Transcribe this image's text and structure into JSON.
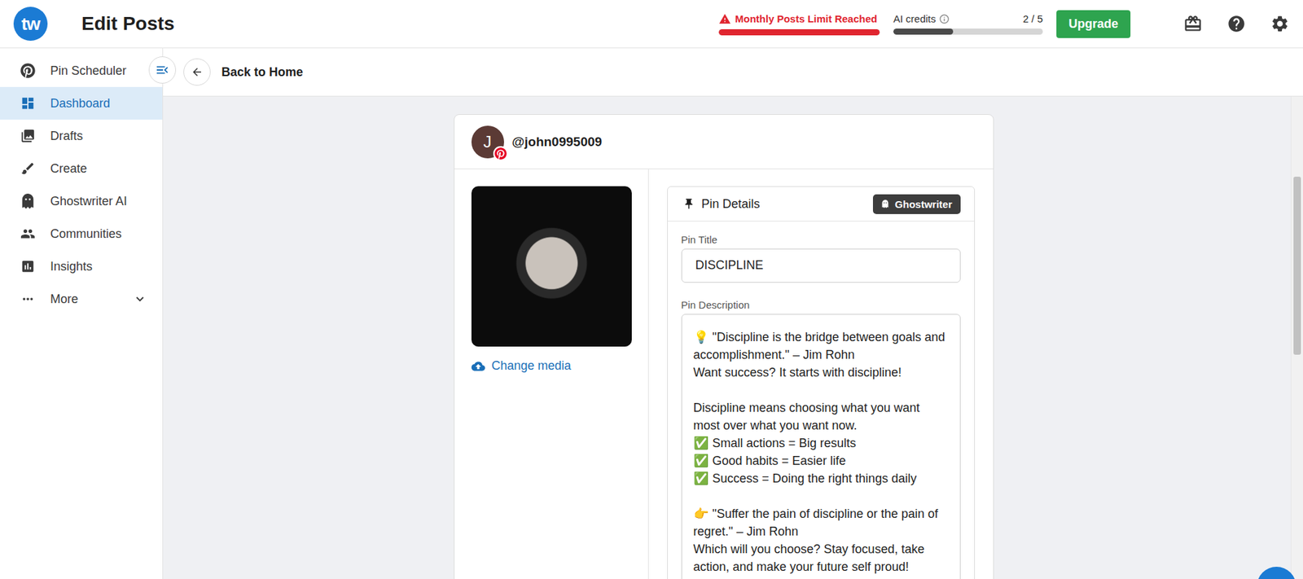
{
  "header": {
    "logo": "tw",
    "title": "Edit Posts",
    "limit_warning": {
      "label": "Monthly Posts Limit Reached",
      "level": 1
    },
    "credits": {
      "label": "AI credits",
      "reading": "2 / 5",
      "level": 0.4
    },
    "upgrade_button": "Upgrade"
  },
  "sidebar": {
    "items": [
      {
        "label": "Pin Scheduler",
        "icon": "pinterest",
        "selected": false
      },
      {
        "label": "Dashboard",
        "icon": "dashboard",
        "selected": true
      },
      {
        "label": "Drafts",
        "icon": "drafts",
        "selected": false
      },
      {
        "label": "Create",
        "icon": "create",
        "selected": false
      },
      {
        "label": "Ghostwriter AI",
        "icon": "ghost",
        "selected": false
      },
      {
        "label": "Communities",
        "icon": "communities",
        "selected": false
      },
      {
        "label": "Insights",
        "icon": "insights",
        "selected": false
      },
      {
        "label": "More",
        "icon": "more",
        "selected": false,
        "expandable": true
      }
    ]
  },
  "subheader": {
    "back_label": "Back to Home"
  },
  "post": {
    "account": {
      "initial": "J",
      "handle": "@john0995009"
    },
    "change_media": "Change media",
    "details": {
      "title": "Pin Details",
      "ghostwriter_button": "Ghostwriter",
      "pin_title_label": "Pin Title",
      "pin_title": "DISCIPLINE",
      "description_label": "Pin Description",
      "description": [
        {
          "icon": "💡",
          "text": "\"Discipline is the bridge between goals and accomplishment.\" – Jim Rohn"
        },
        {
          "icon": "",
          "text": "Want success? It starts with discipline!"
        },
        {
          "icon": "",
          "text": ""
        },
        {
          "icon": "",
          "text": "Discipline means choosing what you want most over what you want now."
        },
        {
          "icon": "✅",
          "text": "Small actions = Big results"
        },
        {
          "icon": "✅",
          "text": "Good habits = Easier life"
        },
        {
          "icon": "✅",
          "text": "Success = Doing the right things daily"
        },
        {
          "icon": "",
          "text": ""
        },
        {
          "icon": "👉",
          "text": "\"Suffer the pain of discipline or the pain of regret.\" – Jim Rohn"
        },
        {
          "icon": "",
          "text": "Which will you choose? Stay focused, take action, and make your future self proud!"
        }
      ]
    }
  }
}
